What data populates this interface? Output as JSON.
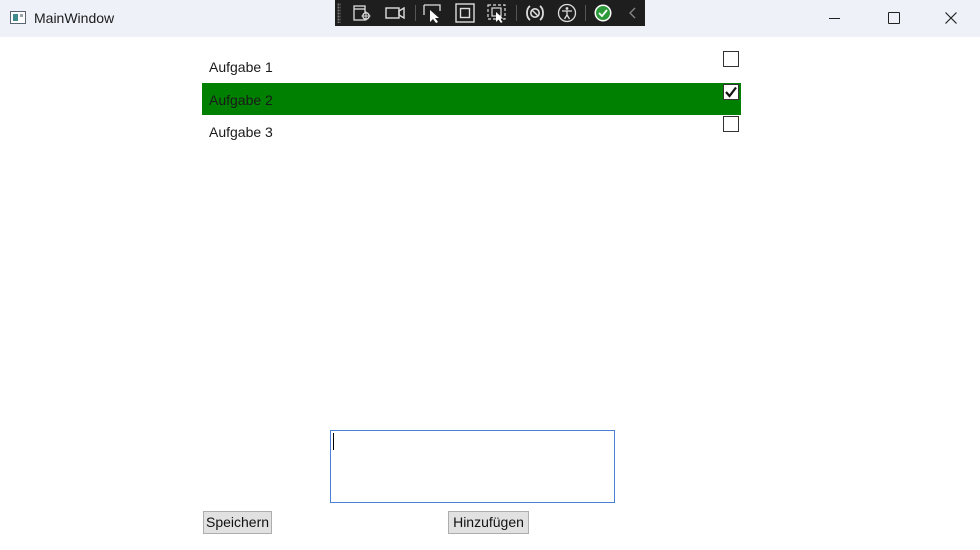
{
  "window": {
    "title": "MainWindow",
    "controls": [
      "minimize-icon",
      "maximize-icon",
      "close-icon"
    ]
  },
  "debug_toolbar": {
    "icons": [
      "live-visual-tree-icon",
      "record-icon",
      "select-element-icon",
      "display-layout-adorners-icon",
      "track-focused-element-icon",
      "binding-failures-icon",
      "accessibility-checker-icon",
      "hot-reload-ok-icon",
      "collapse-chevron-icon"
    ]
  },
  "tasks": [
    {
      "label": "Aufgabe 1",
      "checked": false,
      "selected": false
    },
    {
      "label": "Aufgabe 2",
      "checked": true,
      "selected": true
    },
    {
      "label": "Aufgabe 3",
      "checked": false,
      "selected": false
    }
  ],
  "colors": {
    "selected_row": "#008000",
    "input_border": "#4a7fd6",
    "titlebar": "#eef2f8"
  },
  "input": {
    "value": "",
    "placeholder": ""
  },
  "buttons": {
    "save_label": "Speichern",
    "add_label": "Hinzufügen"
  }
}
